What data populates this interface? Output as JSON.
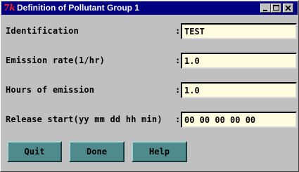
{
  "window": {
    "title": "Definition of Pollutant Group 1",
    "app_icon": "tk-icon",
    "app_icon_glyph": "7k",
    "controls": [
      "minimize-icon",
      "maximize-icon",
      "close-icon"
    ]
  },
  "form": {
    "fields": [
      {
        "label": "Identification",
        "value": "TEST"
      },
      {
        "label": "Emission rate(1/hr)",
        "value": "1.0"
      },
      {
        "label": "Hours of emission",
        "value": "1.0"
      },
      {
        "label": "Release start(yy mm dd hh min)",
        "value": "00 00 00 00 00"
      }
    ],
    "separator": ":"
  },
  "buttons": {
    "quit": "Quit",
    "done": "Done",
    "help": "Help"
  },
  "colors": {
    "titlebar": "#000080",
    "button_face": "#4f8a8c",
    "input_bg": "#fffce0",
    "window_bg": "#c0c0c0"
  }
}
